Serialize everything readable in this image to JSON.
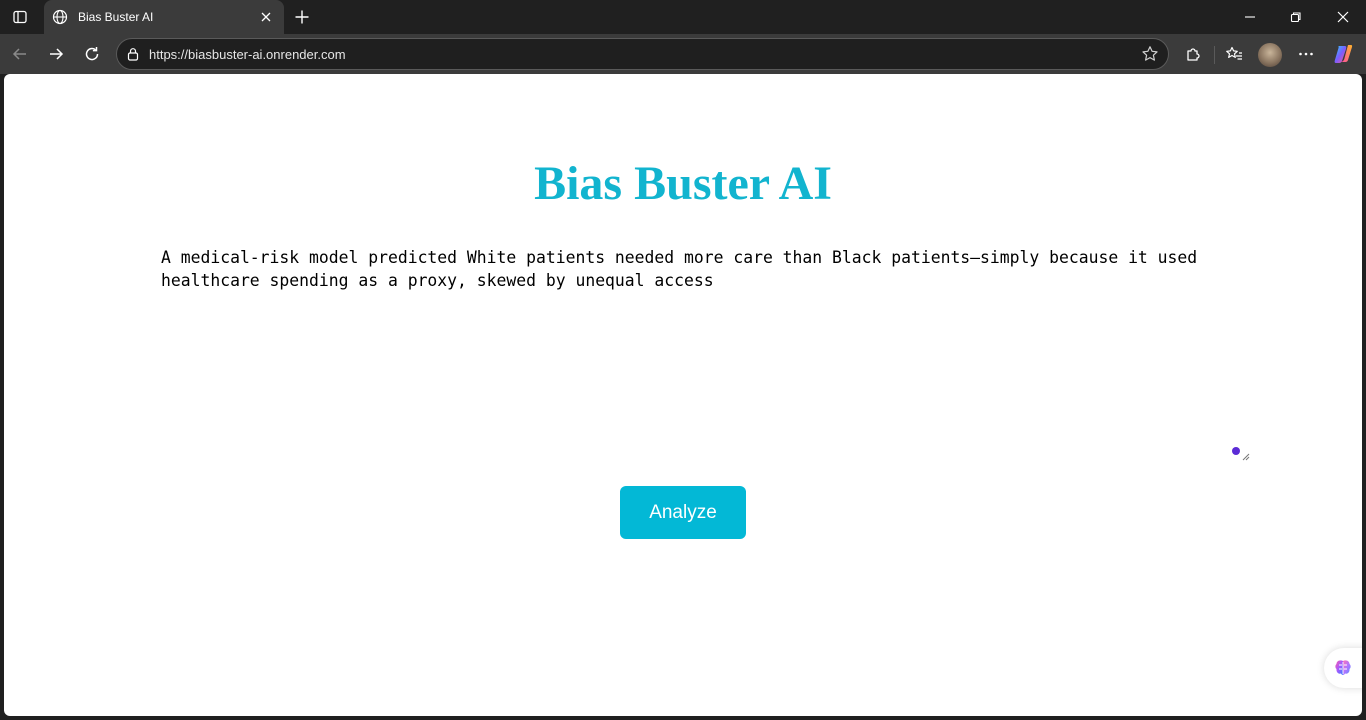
{
  "browser": {
    "tab": {
      "title": "Bias Buster AI"
    },
    "address": {
      "url": "https://biasbuster-ai.onrender.com"
    }
  },
  "page": {
    "title": "Bias Buster AI",
    "input_text": "A medical-risk model predicted White patients needed more care than Black patients—simply because it used healthcare spending as a proxy, skewed by unequal access",
    "analyze_label": "Analyze"
  },
  "colors": {
    "accent": "#12b4cf",
    "button": "#03b8d6",
    "chrome_bg": "#202020",
    "toolbar_bg": "#3b3b3b"
  },
  "icons": [
    "tab-actions-icon",
    "globe-icon",
    "close-icon",
    "plus-icon",
    "minimize-icon",
    "restore-icon",
    "window-close-icon",
    "back-icon",
    "forward-icon",
    "refresh-icon",
    "lock-icon",
    "star-icon",
    "extensions-icon",
    "favorites-icon",
    "more-icon",
    "copilot-icon"
  ]
}
